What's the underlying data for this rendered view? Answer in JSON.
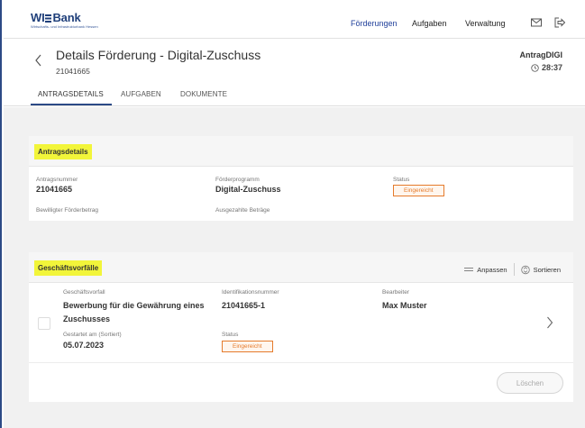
{
  "brand": {
    "logo_text": "WI",
    "logo_text_2": "Bank",
    "tagline": "Wirtschafts- und Infrastrukturbank Hessen"
  },
  "nav": {
    "items": [
      "Förderungen",
      "Aufgaben",
      "Verwaltung"
    ],
    "active_index": 0
  },
  "icons": {
    "mail": "mail-icon",
    "logout": "logout-icon",
    "back": "chevron-left-icon",
    "clock": "clock-icon",
    "customize": "list-icon",
    "sort": "sort-icon",
    "row": "chevron-right-icon"
  },
  "page": {
    "title": "Details Förderung - Digital-Zuschuss",
    "id": "21041665",
    "app_code": "AntragDIGI",
    "timer": "28:37"
  },
  "tabs": [
    "ANTRAGSDETAILS",
    "AUFGABEN",
    "DOKUMENTE"
  ],
  "antragsdetails": {
    "heading": "Antragsdetails",
    "antragsnummer_label": "Antragsnummer",
    "antragsnummer_value": "21041665",
    "foerderprogramm_label": "Förderprogramm",
    "foerderprogramm_value": "Digital-Zuschuss",
    "status_label": "Status",
    "status_value": "Eingereicht",
    "bewilligt_label": "Bewilligter Förderbetrag",
    "ausgezahlt_label": "Ausgezahlte Beträge"
  },
  "geschaeftsvorfaelle": {
    "heading": "Geschäftsvorfälle",
    "customize_label": "Anpassen",
    "sort_label": "Sortieren",
    "col_vorfall": "Geschäftsvorfall",
    "col_id": "Identifikationsnummer",
    "col_bearbeiter": "Bearbeiter",
    "row": {
      "vorfall_line1": "Bewerbung für die Gewährung eines",
      "vorfall_line2": "Zuschusses",
      "id": "21041665-1",
      "bearbeiter": "Max Muster",
      "started_label": "Gestartet am (Sortiert)",
      "started_value": "05.07.2023",
      "status_label": "Status",
      "status_value": "Eingereicht"
    },
    "delete_label": "Löschen"
  },
  "colors": {
    "accent": "#2c4a86",
    "highlight": "#f2f53a",
    "status": "#e57b2c"
  }
}
